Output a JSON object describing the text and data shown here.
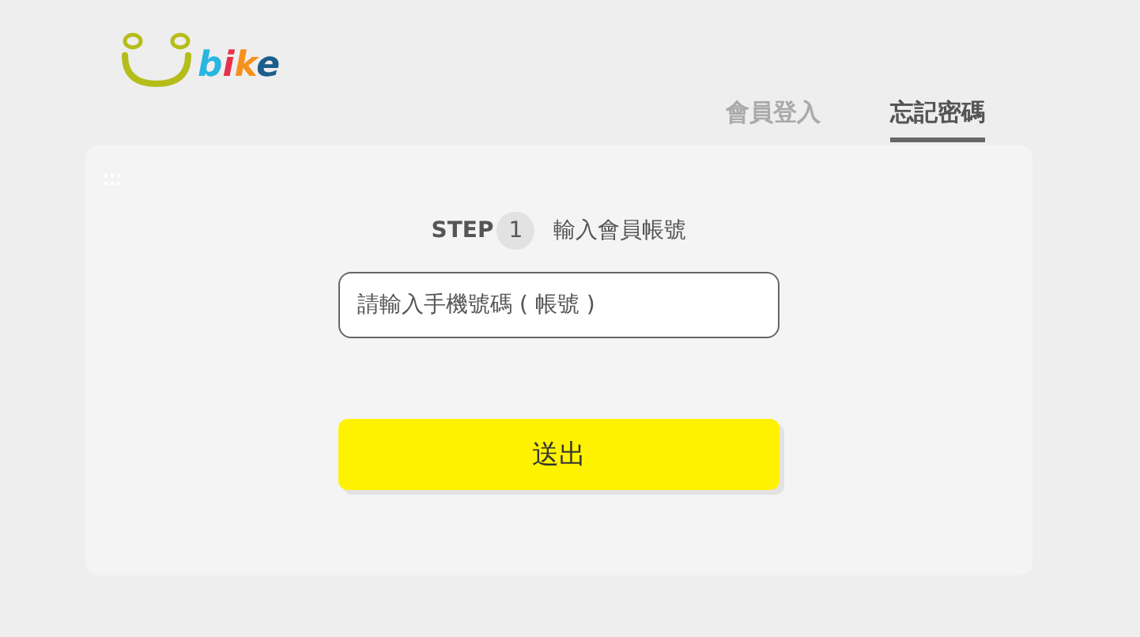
{
  "logo": {
    "text": "bike"
  },
  "tabs": [
    {
      "label": "會員登入",
      "selected": false
    },
    {
      "label": "忘記密碼",
      "selected": true
    }
  ],
  "step": {
    "label": "STEP",
    "number": "1",
    "title": "輸入會員帳號"
  },
  "phone_field": {
    "placeholder": "請輸入手機號碼 ( 帳號 )"
  },
  "submit_button": {
    "label": "送出"
  }
}
